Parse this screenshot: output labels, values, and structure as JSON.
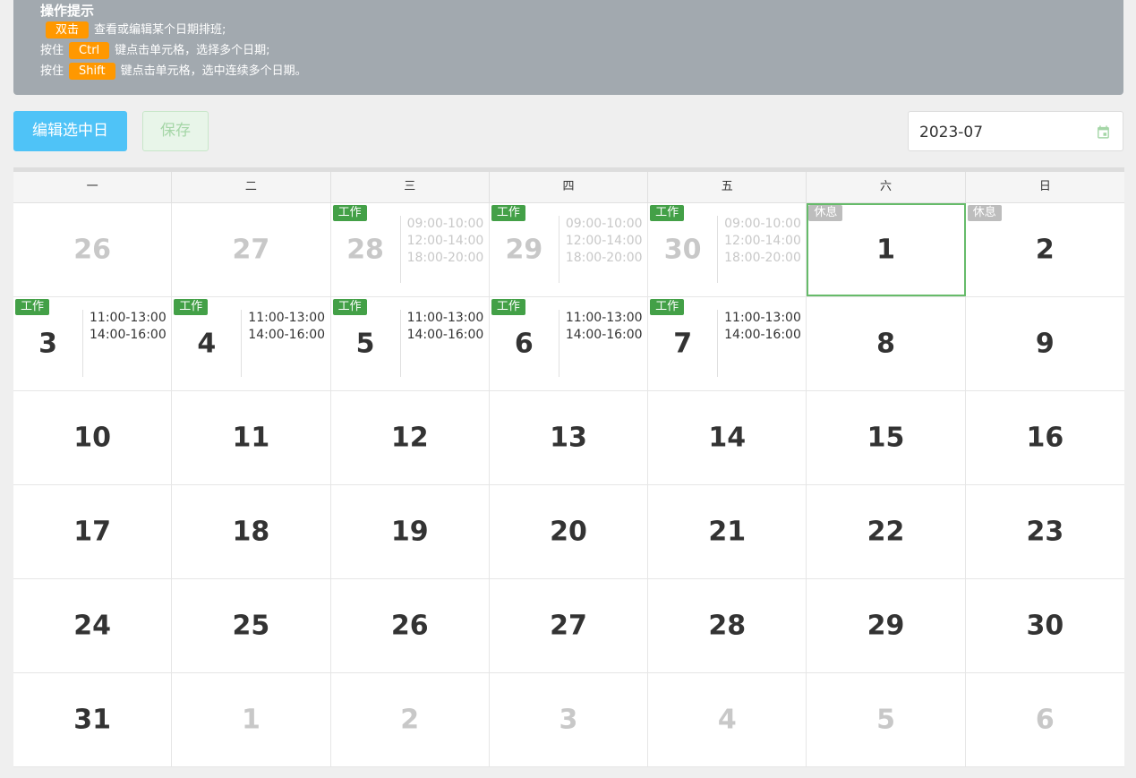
{
  "tips": {
    "title": "操作提示",
    "line1": {
      "prefix": "",
      "key": "双击",
      "suffix": "查看或编辑某个日期排班;"
    },
    "line2": {
      "prefix": "按住",
      "key": "Ctrl",
      "suffix": "键点击单元格，选择多个日期;"
    },
    "line3": {
      "prefix": "按住",
      "key": "Shift",
      "suffix": "键点击单元格，选中连续多个日期。"
    }
  },
  "toolbar": {
    "edit_label": "编辑选中日",
    "save_label": "保存",
    "month_value": "2023-07",
    "month_icon": "calendar-icon"
  },
  "colors": {
    "work_badge": "#43a047",
    "rest_badge": "#bdbdbd",
    "key_badge": "#ff9800",
    "edit_button": "#4fc3f7",
    "selected_outline": "#66bb6a"
  },
  "calendar": {
    "weekdays": [
      "一",
      "二",
      "三",
      "四",
      "五",
      "六",
      "日"
    ],
    "weeks": [
      [
        {
          "day": "26",
          "other": true
        },
        {
          "day": "27",
          "other": true
        },
        {
          "day": "28",
          "other": true,
          "badge": "工作",
          "times": [
            "09:00-10:00",
            "12:00-14:00",
            "18:00-20:00"
          ]
        },
        {
          "day": "29",
          "other": true,
          "badge": "工作",
          "times": [
            "09:00-10:00",
            "12:00-14:00",
            "18:00-20:00"
          ]
        },
        {
          "day": "30",
          "other": true,
          "badge": "工作",
          "times": [
            "09:00-10:00",
            "12:00-14:00",
            "18:00-20:00"
          ]
        },
        {
          "day": "1",
          "selected": true,
          "badge": "休息",
          "rest": true
        },
        {
          "day": "2",
          "badge": "休息",
          "rest": true
        }
      ],
      [
        {
          "day": "3",
          "badge": "工作",
          "times": [
            "11:00-13:00",
            "14:00-16:00"
          ]
        },
        {
          "day": "4",
          "badge": "工作",
          "times": [
            "11:00-13:00",
            "14:00-16:00"
          ]
        },
        {
          "day": "5",
          "badge": "工作",
          "times": [
            "11:00-13:00",
            "14:00-16:00"
          ]
        },
        {
          "day": "6",
          "badge": "工作",
          "times": [
            "11:00-13:00",
            "14:00-16:00"
          ]
        },
        {
          "day": "7",
          "badge": "工作",
          "times": [
            "11:00-13:00",
            "14:00-16:00"
          ]
        },
        {
          "day": "8"
        },
        {
          "day": "9"
        }
      ],
      [
        {
          "day": "10"
        },
        {
          "day": "11"
        },
        {
          "day": "12"
        },
        {
          "day": "13"
        },
        {
          "day": "14"
        },
        {
          "day": "15"
        },
        {
          "day": "16"
        }
      ],
      [
        {
          "day": "17"
        },
        {
          "day": "18"
        },
        {
          "day": "19"
        },
        {
          "day": "20"
        },
        {
          "day": "21"
        },
        {
          "day": "22"
        },
        {
          "day": "23"
        }
      ],
      [
        {
          "day": "24"
        },
        {
          "day": "25"
        },
        {
          "day": "26"
        },
        {
          "day": "27"
        },
        {
          "day": "28"
        },
        {
          "day": "29"
        },
        {
          "day": "30"
        }
      ],
      [
        {
          "day": "31"
        },
        {
          "day": "1",
          "other": true
        },
        {
          "day": "2",
          "other": true
        },
        {
          "day": "3",
          "other": true
        },
        {
          "day": "4",
          "other": true
        },
        {
          "day": "5",
          "other": true
        },
        {
          "day": "6",
          "other": true
        }
      ]
    ]
  }
}
